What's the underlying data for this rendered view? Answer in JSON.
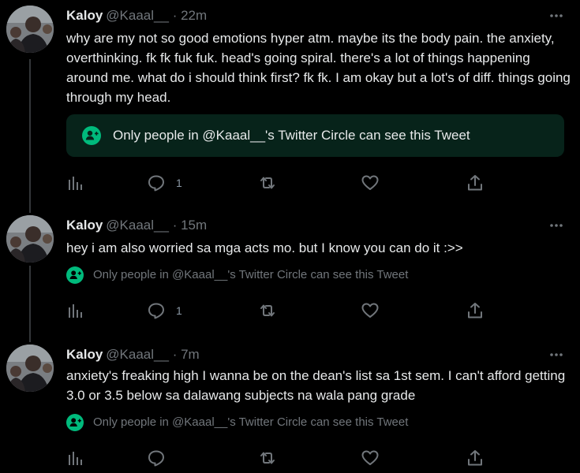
{
  "colors": {
    "background": "#000000",
    "text": "#e7e9ea",
    "muted": "#71767b",
    "circle_green": "#00ba7c",
    "circle_box_bg": "#07231a"
  },
  "tweets": [
    {
      "name": "Kaloy",
      "handle": "@Kaaal__",
      "separator": "·",
      "time": "22m",
      "text": "why are my not so good emotions hyper atm. maybe its the body pain. the anxiety, overthinking. fk fk fuk fuk. head's going spiral. there's a lot of things happening around me. what do i should think first? fk fk. I am okay but a lot's of diff. things going through my head.",
      "circle_notice": "Only people in @Kaaal__'s Twitter Circle can see this Tweet",
      "reply_count": "1",
      "icons": [
        "more-icon",
        "twitter-circle-icon",
        "analytics-icon",
        "reply-icon",
        "retweet-icon",
        "like-icon",
        "share-icon"
      ]
    },
    {
      "name": "Kaloy",
      "handle": "@Kaaal__",
      "separator": "·",
      "time": "15m",
      "text": "hey i am also worried sa mga acts mo. but I know you can do it :>>",
      "circle_notice": "Only people in @Kaaal__'s Twitter Circle can see this Tweet",
      "reply_count": "1",
      "icons": [
        "more-icon",
        "twitter-circle-icon",
        "analytics-icon",
        "reply-icon",
        "retweet-icon",
        "like-icon",
        "share-icon"
      ]
    },
    {
      "name": "Kaloy",
      "handle": "@Kaaal__",
      "separator": "·",
      "time": "7m",
      "text": "anxiety's freaking high I wanna be on the dean's list sa 1st sem. I can't afford getting 3.0 or 3.5 below sa dalawang subjects na wala pang grade",
      "circle_notice": "Only people in @Kaaal__'s Twitter Circle can see this Tweet",
      "reply_count": "",
      "icons": [
        "more-icon",
        "twitter-circle-icon",
        "analytics-icon",
        "reply-icon",
        "retweet-icon",
        "like-icon",
        "share-icon"
      ]
    }
  ]
}
